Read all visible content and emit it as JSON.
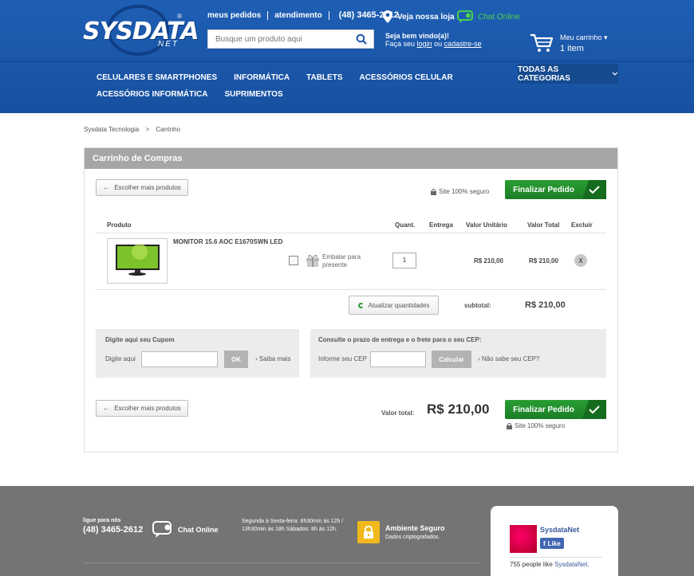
{
  "header": {
    "logo_text": "SYSDATA",
    "logo_sub": "NET",
    "logo_reg": "®",
    "links": [
      "meus pedidos",
      "atendimento"
    ],
    "phone": "(48) 3465-2612",
    "store_label": "Veja nossa loja",
    "chat_label": "Chat Online",
    "search_placeholder": "Busque um produto aqui",
    "welcome_title": "Seja bem vindo(a)!",
    "welcome_prefix": "Faça seu",
    "welcome_login": "login",
    "welcome_or": "ou",
    "welcome_signup": "cadastre-se",
    "cart_label": "Meu carrinho",
    "cart_count": "1 item"
  },
  "nav": {
    "row1": [
      "CELULARES E SMARTPHONES",
      "INFORMÁTICA",
      "TABLETS",
      "ACESSÓRIOS CELULAR"
    ],
    "row2": [
      "ACESSÓRIOS INFORMÁTICA",
      "SUPRIMENTOS"
    ],
    "all_categories": "TODAS AS CATEGORIAS"
  },
  "breadcrumb": {
    "home": "Sysdata Tecnologia",
    "sep": ">",
    "current": "Carrinho"
  },
  "cart": {
    "title": "Carrinho de Compras",
    "continue_label": "Escolher mais produtos",
    "secure_label": "Site 100% seguro",
    "checkout_label": "Finalizar Pedido",
    "columns": {
      "product": "Produto",
      "qty": "Quant.",
      "delivery": "Entrega",
      "unit": "Valor Unitário",
      "total": "Valor Total",
      "remove": "Excluir"
    },
    "item": {
      "name": "MONITOR 15.6 AOC E1670SWN LED",
      "gift_label": "Embalar para presente",
      "qty": "1",
      "unit_price": "R$ 210,00",
      "total_price": "R$ 210,00",
      "remove": "X"
    },
    "update_label": "Atualizar quantidades",
    "subtotal_label": "subtotal:",
    "subtotal_value": "R$ 210,00",
    "coupon": {
      "title": "Digite aqui seu Cupom",
      "field_label": "Digite aqui",
      "ok": "OK",
      "more": "Saiba mais"
    },
    "shipping": {
      "title": "Consulte o prazo de entrega e o frete para o seu CEP:",
      "field_label": "Informe seu CEP",
      "calc": "Calcular",
      "help": "Não sabe seu CEP?"
    },
    "total_label": "Valor total:",
    "total_value": "R$ 210,00"
  },
  "footer": {
    "call_small": "ligue para nós",
    "phone": "(48) 3465-2612",
    "chat": "Chat Online",
    "hours": "Segunda à Sexta-feira: 8h30min às 12h / 13h30min às 18h Sábados: 8h às 12h.",
    "secure_title": "Ambiente Seguro",
    "secure_sub": "Dados criptografados.",
    "fb_name": "SysdataNet",
    "fb_like": "Like",
    "fb_count": "755 people like",
    "fb_link": "SysdataNet."
  }
}
